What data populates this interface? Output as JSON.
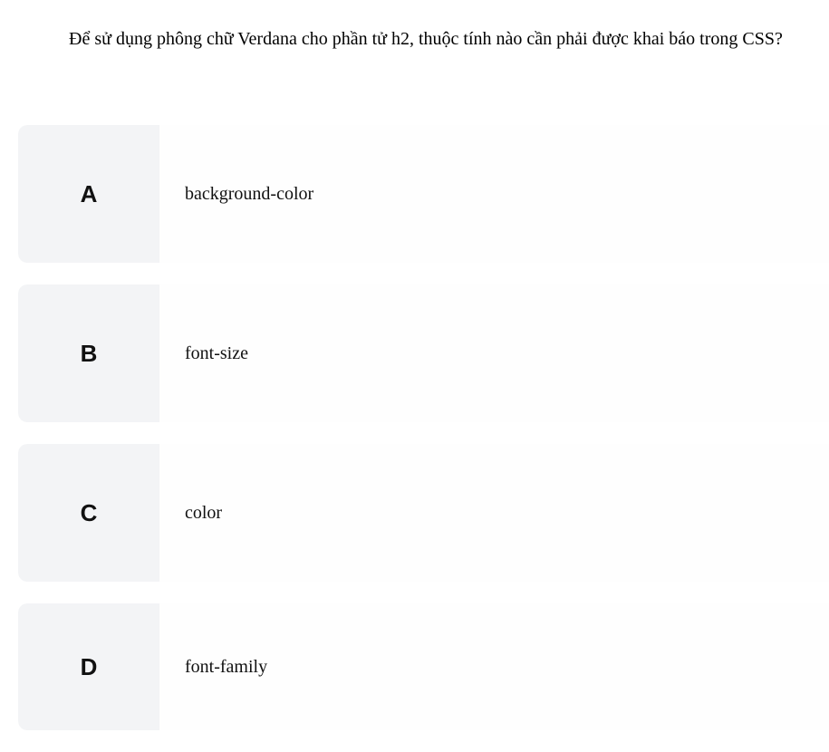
{
  "question": "Để sử dụng phông chữ Verdana cho phần tử h2, thuộc tính nào cần phải được khai báo trong CSS?",
  "options": [
    {
      "letter": "A",
      "text": "background-color"
    },
    {
      "letter": "B",
      "text": "font-size"
    },
    {
      "letter": "C",
      "text": "color"
    },
    {
      "letter": "D",
      "text": "font-family"
    }
  ]
}
